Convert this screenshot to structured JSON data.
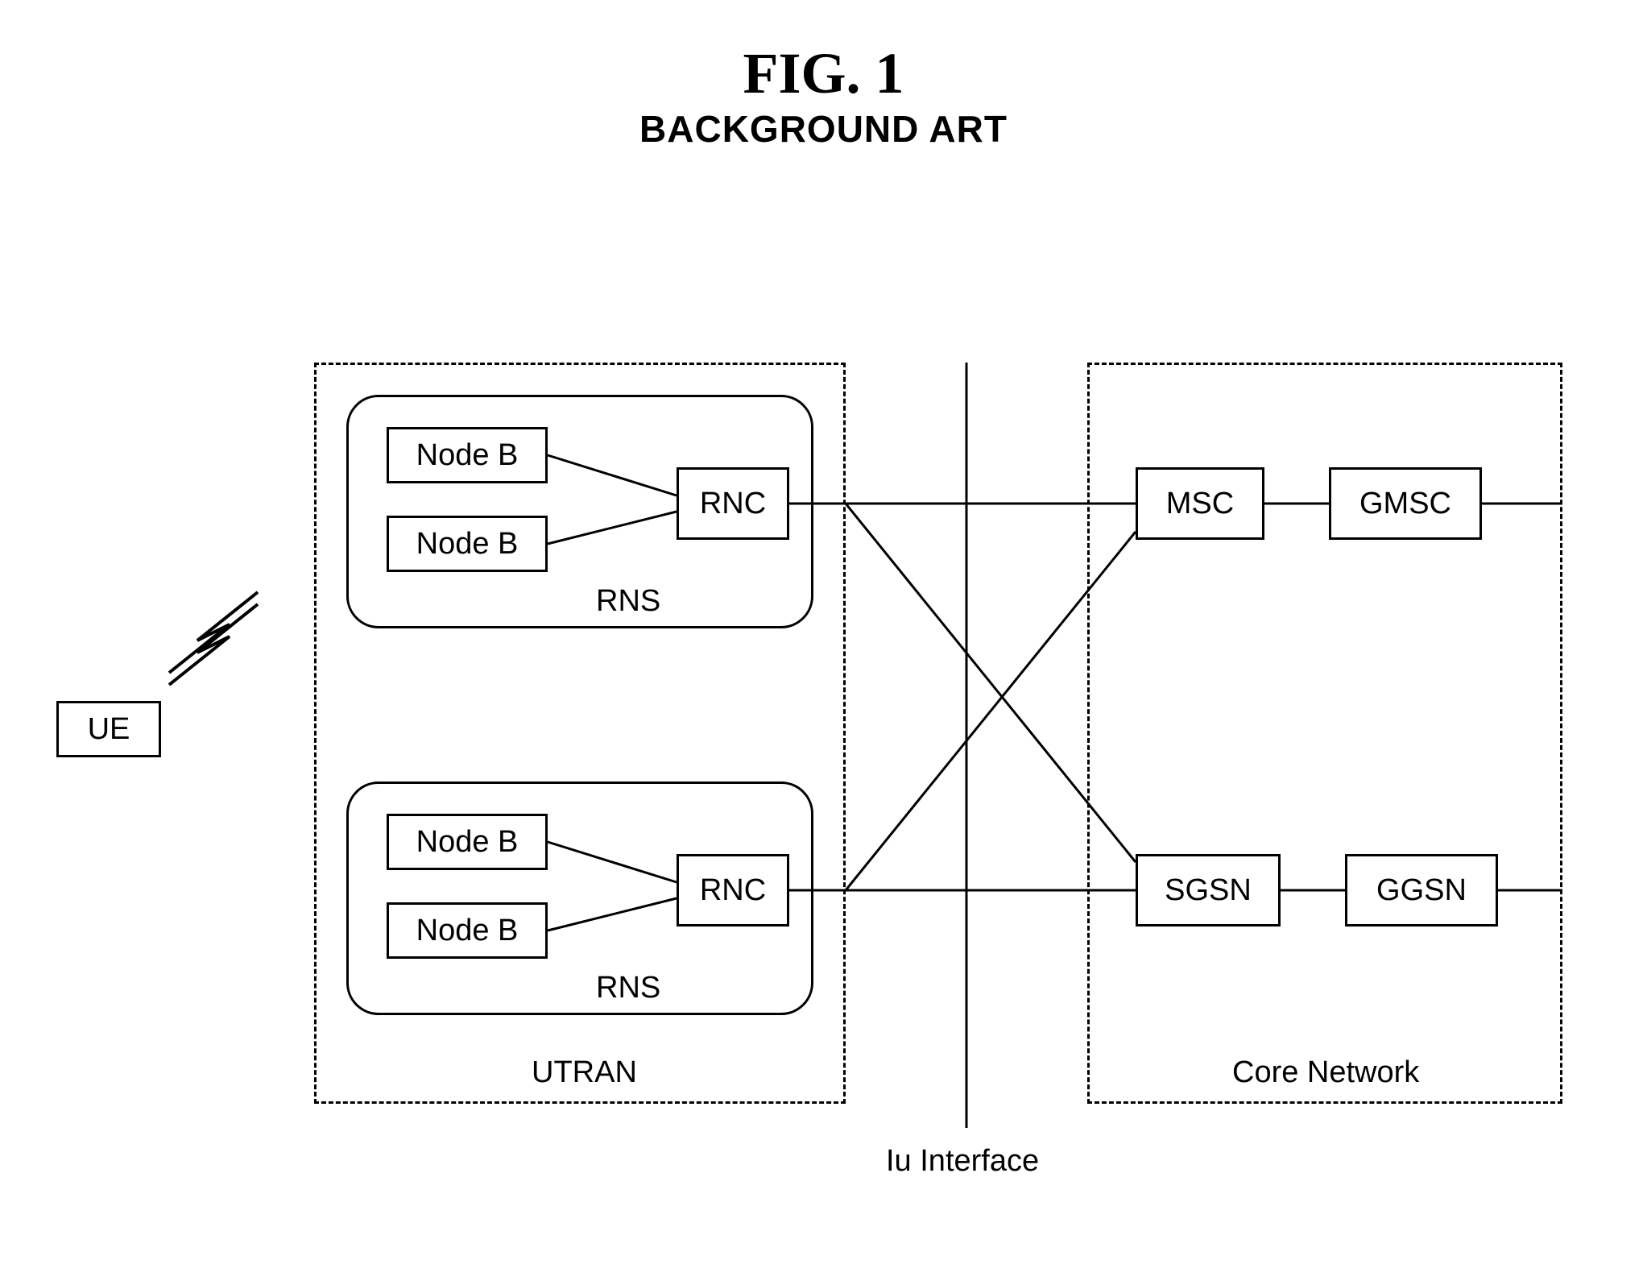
{
  "title": {
    "main": "FIG. 1",
    "sub": "BACKGROUND ART"
  },
  "nodes": {
    "ue": "UE",
    "nodeB1": "Node B",
    "nodeB2": "Node B",
    "nodeB3": "Node B",
    "nodeB4": "Node B",
    "rnc1": "RNC",
    "rnc2": "RNC",
    "msc": "MSC",
    "gmsc": "GMSC",
    "sgsn": "SGSN",
    "ggsn": "GGSN"
  },
  "labels": {
    "rns1": "RNS",
    "rns2": "RNS",
    "utran": "UTRAN",
    "coreNetwork": "Core Network",
    "iuInterface": "Iu Interface"
  }
}
